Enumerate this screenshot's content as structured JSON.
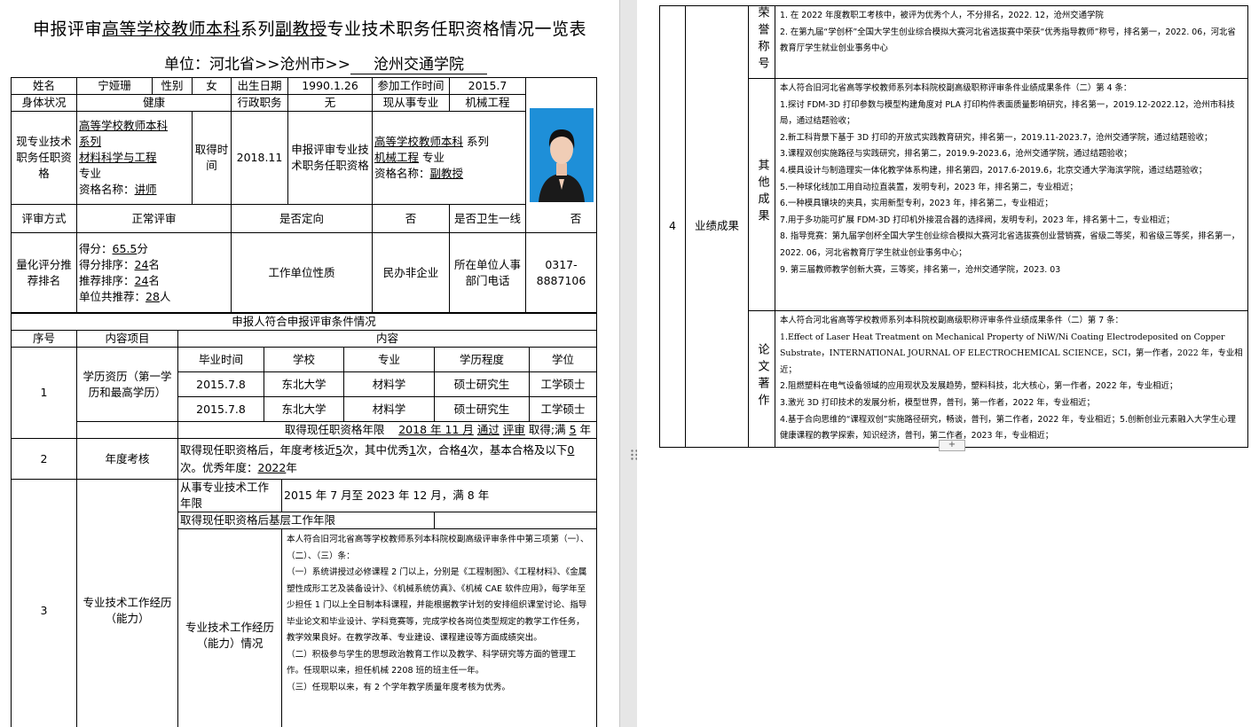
{
  "doc": {
    "title_p1": "申报评审",
    "title_u1": "高等学校教师本科",
    "title_p2": "系列",
    "title_u2": "副教授",
    "title_p3": "专业技术职务任职资格情况一览表",
    "unit_label": "单位：河北省>>沧州市>>",
    "unit_value": "沧州交通学院"
  },
  "basic": {
    "name_label": "姓名",
    "name": "宁娅珊",
    "gender_label": "性别",
    "gender": "女",
    "birth_label": "出生日期",
    "birth": "1990.1.26",
    "work_label": "参加工作时间",
    "work": "2015.7",
    "health_label": "身体状况",
    "health": "健康",
    "admin_label": "行政职务",
    "admin": "无",
    "major_label": "现从事专业",
    "major": "机械工程",
    "cur_label": "现专业技术职务任职资格",
    "cur_l1": "高等学校教师本科",
    "cur_l2": "系列",
    "cur_l3": "材料科学与工程",
    "cur_l4": "专业",
    "cur_l5": "资格名称：",
    "cur_l5u": "讲师",
    "obtain_label": "取得时间",
    "obtain": "2018.11",
    "apply_label": "申报评审专业技术职务任职资格",
    "apply_l1": "高等学校教师本科",
    "apply_l1b": "系列",
    "apply_l2": "机械工程",
    "apply_l2b": "专业",
    "apply_l3": "资格名称：",
    "apply_l3u": "副教授",
    "review_label": "评审方式",
    "review": "正常评审",
    "directed_label": "是否定向",
    "directed": "否",
    "health_line_label": "是否卫生一线",
    "health_line": "否",
    "quant_label": "量化评分推荐排名",
    "score_label": "得分：",
    "score": "65.5",
    "score_unit": "分",
    "rank1_label": "得分排序：",
    "rank1": "24",
    "rank1_unit": "名",
    "rank2_label": "推荐排序：",
    "rank2": "24",
    "rank2_unit": "名",
    "total_label": "单位共推荐：",
    "total": "28",
    "total_unit": "人",
    "nature_label": "工作单位性质",
    "nature": "民办非企业",
    "phone_label": "所在单位人事部门电话",
    "phone": "0317-8887106"
  },
  "conditions": {
    "header": "申报人符合申报评审条件情况",
    "col_no": "序号",
    "col_item": "内容项目",
    "col_content": "内容",
    "r1": {
      "no": "1",
      "item": "学历资历（第一学历和最高学历）",
      "h_time": "毕业时间",
      "h_school": "学校",
      "h_major": "专业",
      "h_level": "学历程度",
      "h_degree": "学位",
      "rows": [
        {
          "time": "2015.7.8",
          "school": "东北大学",
          "major": "材料学",
          "level": "硕士研究生",
          "degree": "工学硕士"
        },
        {
          "time": "2015.7.8",
          "school": "东北大学",
          "major": "材料学",
          "level": "硕士研究生",
          "degree": "工学硕士"
        }
      ],
      "limit_label": "取得现任职资格年限",
      "limit_a": "2018 年 11 月",
      "limit_b": "通过",
      "limit_c": "评审",
      "limit_d": "取得;满",
      "limit_e": "5",
      "limit_f": "年"
    },
    "r2": {
      "no": "2",
      "item": "年度考核",
      "t1": "取得现任职资格后，年度考核近",
      "v1": "5",
      "t2": "次，其中优秀",
      "v2": "1",
      "t3": "次，合格",
      "v3": "4",
      "t4": "次，基本合格及以下",
      "v4": "0",
      "t5": "次。优秀年度：",
      "v5": "2022",
      "t6": "年"
    },
    "r3": {
      "no": "3",
      "item": "专业技术工作经历（能力）",
      "years_label": "从事专业技术工作年限",
      "years_value": "2015 年 7 月至 2023 年 12 月，满 8 年",
      "base_label": "取得现任职资格后基层工作年限",
      "exp_label": "专业技术工作经历（能力）情况",
      "exp_lines": [
        "本人符合旧河北省高等学校教师系列本科院校副高级评审条件中第三项第（一）、（二）、（三）条：",
        "（一）系统讲授过必修课程 2 门以上，分别是《工程制图》、《工程材料》、《金属塑性成形工艺及装备设计》、《机械系统仿真》、《机械 CAE 软件应用》，每学年至少担任 1 门以上全日制本科课程，并能根据教学计划的安排组织课堂讨论、指导毕业论文和毕业设计、学科竞赛等，完成学校各岗位类型规定的教学工作任务，教学效果良好。在教学改革、专业建设、课程建设等方面成绩突出。",
        "（二）积极参与学生的思想政治教育工作以及教学、科学研究等方面的管理工作。任现职以来，担任机械 2208 班的班主任一年。",
        "（三）任现职以来，有 2 个学年教学质量年度考核为优秀。"
      ]
    }
  },
  "right": {
    "no": "4",
    "item": "业绩成果",
    "honor_label": "荣誉称号",
    "honor_lines": [
      "1. 在 2022 年度教职工考核中，被评为优秀个人，不分排名，2022. 12，沧州交通学院",
      "2. 在第九届“学创杯”全国大学生创业综合模拟大赛河北省选拔赛中荣获“优秀指导教师”称号，排名第一，2022. 06，河北省教育厅学生就业创业事务中心"
    ],
    "other_label": "其他成果",
    "other_lines": [
      "本人符合旧河北省高等学校教师系列本科院校副高级职称评审条件业绩成果条件（二）第 4 条：",
      "1.探讨 FDM-3D 打印参数与模型构建角度对 PLA 打印构件表面质量影响研究，排名第一，2019.12-2022.12，沧州市科技局，通过结题验收；",
      "2.新工科背景下基于 3D 打印的开放式实践教育研究，排名第一，2019.11-2023.7，沧州交通学院，通过结题验收；",
      "3.课程双创实施路径与实践研究，排名第二，2019.9-2023.6，沧州交通学院，通过结题验收；",
      "4.模具设计与制造理实一体化教学体系构建，排名第四，2017.6-2019.6，北京交通大学海滨学院，通过结题验收；",
      "5.一种球化线加工用自动拉直装置，发明专利，2023 年，排名第二，专业相近；",
      "6.一种模具镶块的夹具，实用新型专利，2023 年，排名第二，专业相近；",
      "7.用于多功能可扩展 FDM-3D 打印机外接混合器的选择阀，发明专利，2023 年，排名第十二，专业相近；",
      "8. 指导竞赛：第九届学创杯全国大学生创业综合模拟大赛河北省选拔赛创业营销赛，省级二等奖，和省级三等奖，排名第一，2022. 06，河北省教育厅学生就业创业事务中心；",
      "9. 第三届教师教学创新大赛，三等奖，排名第一，沧州交通学院，2023. 03"
    ],
    "paper_label": "论文著作",
    "paper_lines": [
      "本人符合河北省高等学校教师系列本科院校副高级职称评审条件业绩成果条件（二）第 7 条：",
      "1.Effect of Laser Heat Treatment on Mechanical Property of NiW/Ni Coating Electrodeposited on Copper Substrate，INTERNATIONAL JOURNAL OF ELECTROCHEMICAL SCIENCE，SCI，第一作者，2022 年，专业相近；",
      "2.阻燃塑料在电气设备领域的应用现状及发展趋势，塑料科技，北大核心，第一作者，2022 年，专业相近；",
      "3.激光 3D 打印技术的发展分析，模型世界，普刊，第一作者，2022 年，专业相近；",
      "4.基于合向思维的“课程双创”实施路径研究，畅谈，普刊，第二作者，2022 年，专业相近；5.创新创业元素融入大学生心理健康课程的教学探索，知识经济，普刊，第二作者，2023 年，专业相近；"
    ]
  },
  "ui": {
    "add_row_label": "+"
  }
}
